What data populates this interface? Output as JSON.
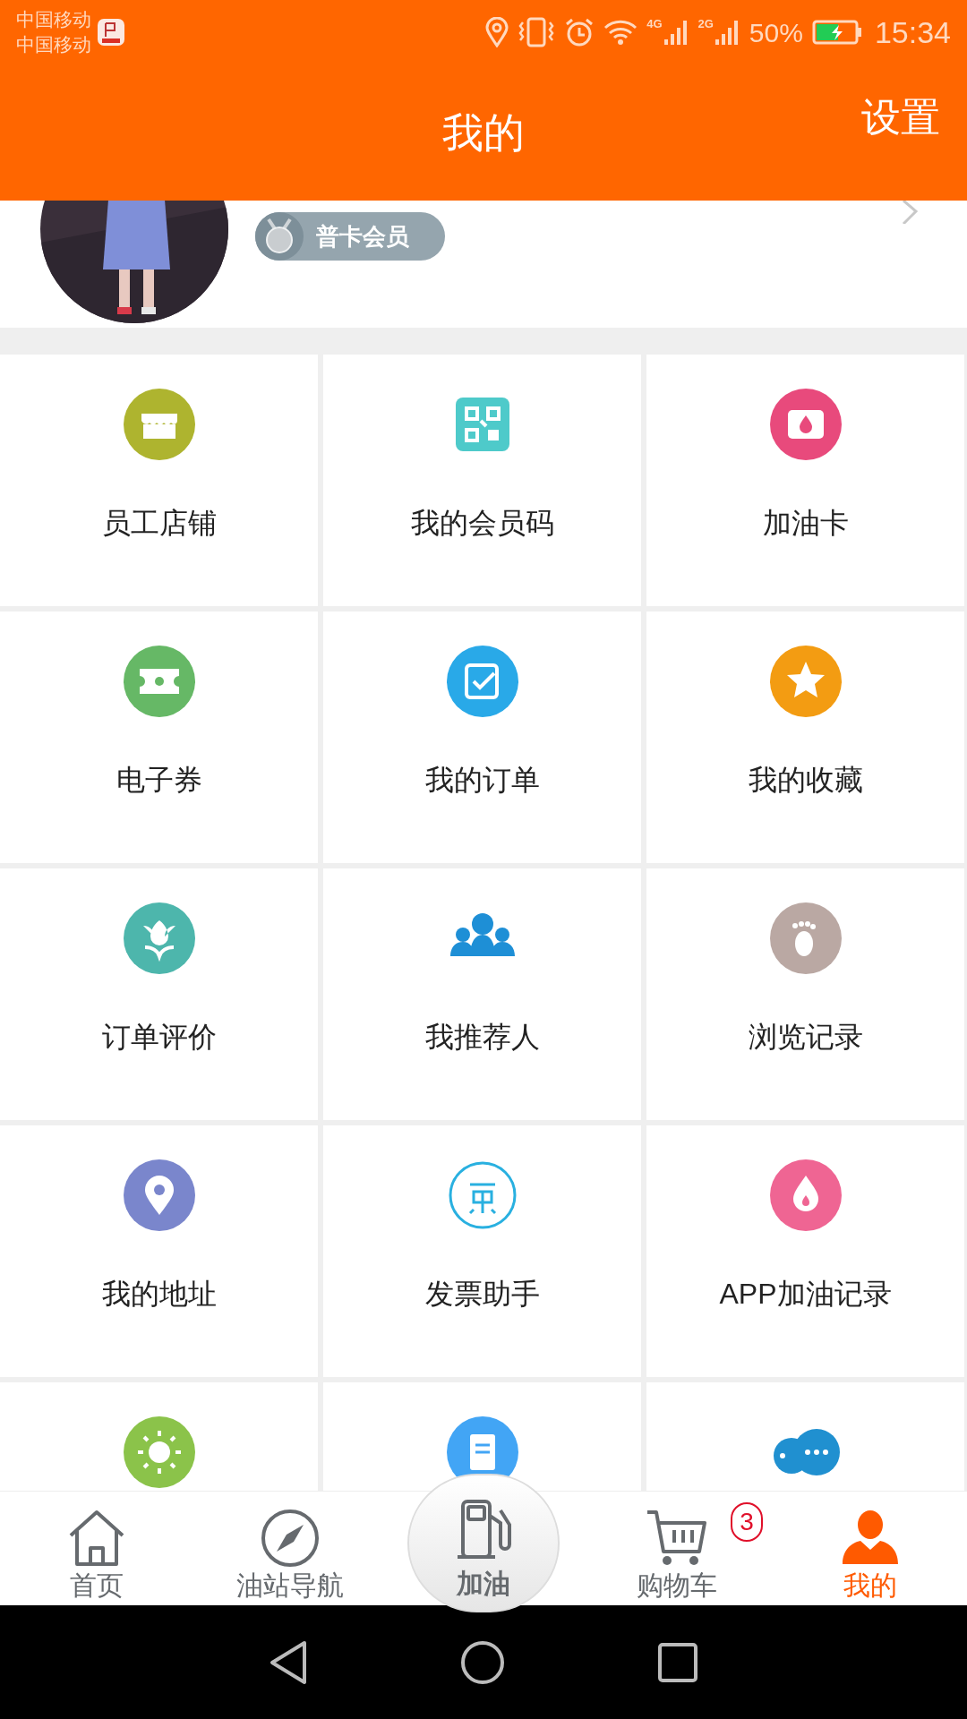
{
  "status_bar": {
    "carriers": [
      "中国移动",
      "中国移动"
    ],
    "network_labels": [
      "4G",
      "2G"
    ],
    "battery": "50%",
    "time": "15:34"
  },
  "header": {
    "title": "我的",
    "action": "设置"
  },
  "profile": {
    "badge": "普卡会员"
  },
  "grid": [
    {
      "label": "员工店铺",
      "kind": "shop",
      "color": "#aeb42f"
    },
    {
      "label": "我的会员码",
      "kind": "qrcode",
      "color": "#4ecaca"
    },
    {
      "label": "加油卡",
      "kind": "card",
      "color": "#e84a7c"
    },
    {
      "label": "电子券",
      "kind": "coupon",
      "color": "#66b866"
    },
    {
      "label": "我的订单",
      "kind": "order",
      "color": "#29a9e8"
    },
    {
      "label": "我的收藏",
      "kind": "star",
      "color": "#f39c12"
    },
    {
      "label": "订单评价",
      "kind": "flower",
      "color": "#4db6ac"
    },
    {
      "label": "我推荐人",
      "kind": "people",
      "color": "#1e8fd6"
    },
    {
      "label": "浏览记录",
      "kind": "foot",
      "color": "#baa8a3"
    },
    {
      "label": "我的地址",
      "kind": "pin",
      "color": "#7a86cc"
    },
    {
      "label": "发票助手",
      "kind": "invoice",
      "color": "#29b0e0"
    },
    {
      "label": "APP加油记录",
      "kind": "drop",
      "color": "#ef6593"
    },
    {
      "kind": "sun",
      "color": "#8bc34a"
    },
    {
      "kind": "doc",
      "color": "#42a5f5"
    },
    {
      "kind": "chat",
      "color": "#2090d0"
    }
  ],
  "tabs": [
    {
      "label": "首页",
      "kind": "home",
      "selected": false
    },
    {
      "label": "油站导航",
      "kind": "compass",
      "selected": false
    },
    {
      "label": "加油",
      "kind": "fuel",
      "selected": false
    },
    {
      "label": "购物车",
      "kind": "cart",
      "selected": false,
      "badge": "3"
    },
    {
      "label": "我的",
      "kind": "user",
      "selected": true
    }
  ]
}
